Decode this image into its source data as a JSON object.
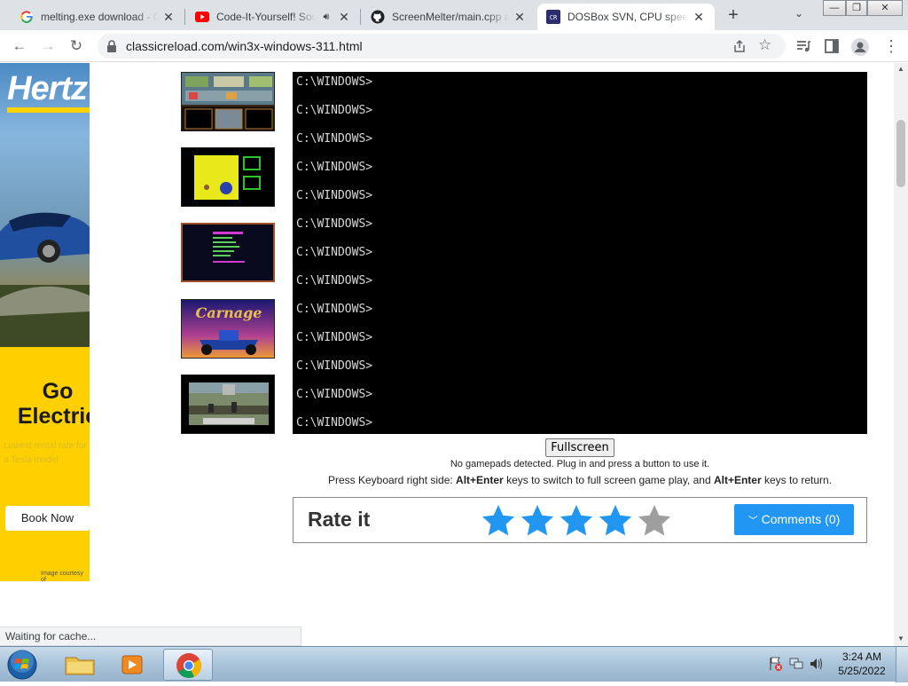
{
  "tabs": [
    {
      "title": "melting.exe download - Google Search",
      "close": "✕"
    },
    {
      "title": "Code-It-Yourself! Sound",
      "close": "✕"
    },
    {
      "title": "ScreenMelter/main.cpp at main",
      "close": "✕"
    },
    {
      "title": "DOSBox SVN, CPU speed",
      "close": "✕"
    }
  ],
  "new_tab": "+",
  "tab_menu": "⌄",
  "window_controls": {
    "minimize": "—",
    "maximize": "❐",
    "close": "✕"
  },
  "nav": {
    "back": "←",
    "forward": "→",
    "reload": "↻"
  },
  "address": {
    "url": "classicreload.com/win3x-windows-311.html"
  },
  "ad": {
    "brand": "Hertz",
    "headline": "Go Electric",
    "fine_print": "Lowest rental rate for a Tesla model",
    "cta": "Book Now",
    "courtesy": "Image courtesy of"
  },
  "emulator": {
    "prompt_lines": [
      "C:\\WINDOWS>",
      "C:\\WINDOWS>",
      "C:\\WINDOWS>",
      "C:\\WINDOWS>",
      "C:\\WINDOWS>",
      "C:\\WINDOWS>",
      "C:\\WINDOWS>",
      "C:\\WINDOWS>",
      "C:\\WINDOWS>",
      "C:\\WINDOWS>",
      "C:\\WINDOWS>",
      "C:\\WINDOWS>",
      "C:\\WINDOWS>"
    ],
    "fullscreen_label": "Fullscreen",
    "gamepad_note": "No gamepads detected. Plug in and press a button to use it.",
    "kb_prefix": "Press Keyboard right side: ",
    "kb_key1": "Alt+Enter",
    "kb_mid": " keys to switch to full screen game play, and ",
    "kb_key2": "Alt+Enter",
    "kb_suffix": " keys to return."
  },
  "rating": {
    "title": "Rate it",
    "stars_filled": 4,
    "stars_total": 5,
    "color_filled": "#2196f3",
    "color_empty": "#9e9e9e",
    "comments_label": "Comments (0)"
  },
  "status_text": "Waiting for cache...",
  "taskbar": {
    "time": "3:24 AM",
    "date": "5/25/2022"
  }
}
